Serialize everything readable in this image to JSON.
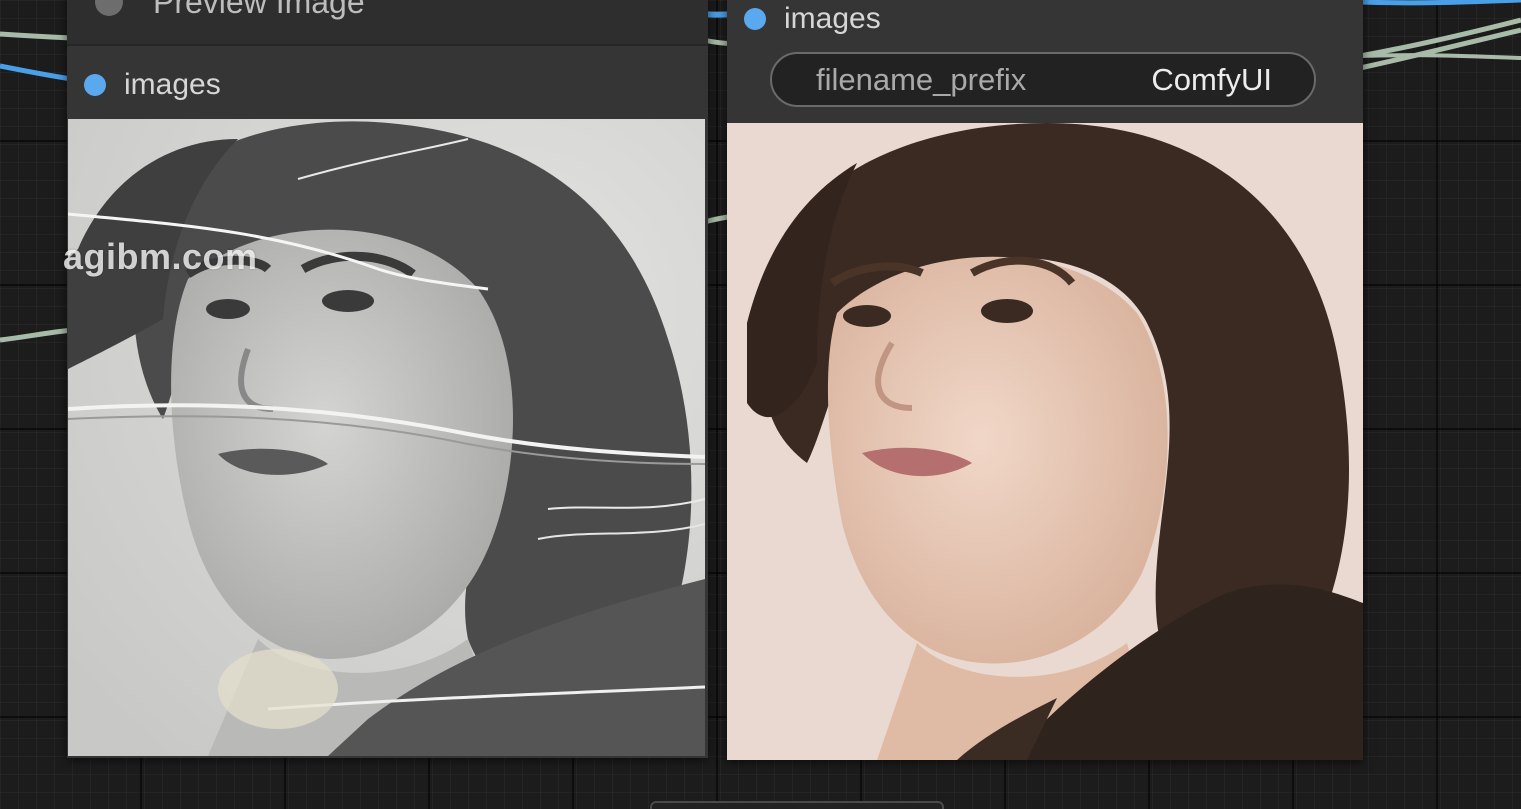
{
  "preview_node": {
    "title": "Preview Image",
    "input_label": "images",
    "image": {
      "alt": "",
      "kind": "black-and-white damaged portrait photograph"
    }
  },
  "save_node": {
    "input_label": "images",
    "widget": {
      "name": "filename_prefix",
      "value": "ComfyUI"
    },
    "image": {
      "alt": "",
      "kind": "restored colorized portrait photograph"
    }
  },
  "watermark": "agibm.com",
  "colors": {
    "canvas_bg": "#1c1c1c",
    "node_body": "#353535",
    "node_title": "#2e2e2e",
    "slot_dot": "#5aa8ee",
    "link_blue": "#4aa0e8",
    "link_green": "#a8bba8",
    "text": "#d6d6d6"
  },
  "icons": {
    "title_dot": "node-collapse-dot-icon",
    "slot_dot": "input-slot-dot-icon"
  }
}
